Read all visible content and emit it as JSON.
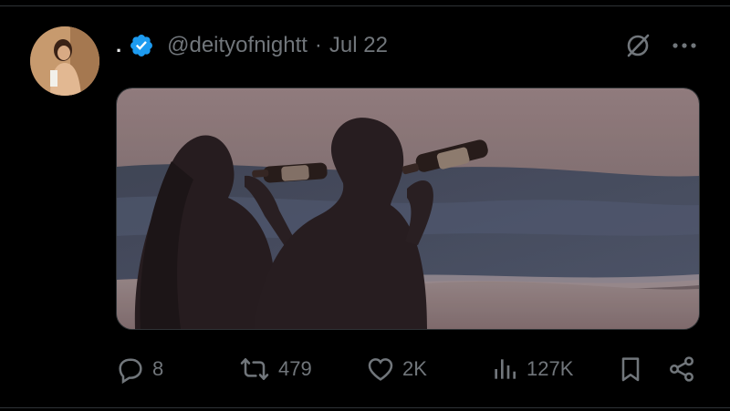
{
  "tweet": {
    "display_name": ".",
    "handle": "@deityofnightt",
    "separator": "·",
    "date": "Jul 22"
  },
  "actions": {
    "replies": "8",
    "reposts": "479",
    "likes": "2K",
    "views": "127K"
  },
  "icons": {
    "verified": "verified-badge-icon",
    "grok": "grok-icon",
    "more": "more-icon",
    "reply": "reply-icon",
    "repost": "repost-icon",
    "like": "heart-icon",
    "views": "analytics-icon",
    "bookmark": "bookmark-icon",
    "share": "share-icon"
  },
  "colors": {
    "background": "#000000",
    "text_primary": "#e7e9ea",
    "text_secondary": "#71767b",
    "verified": "#1d9bf0",
    "border": "#2f3336"
  }
}
